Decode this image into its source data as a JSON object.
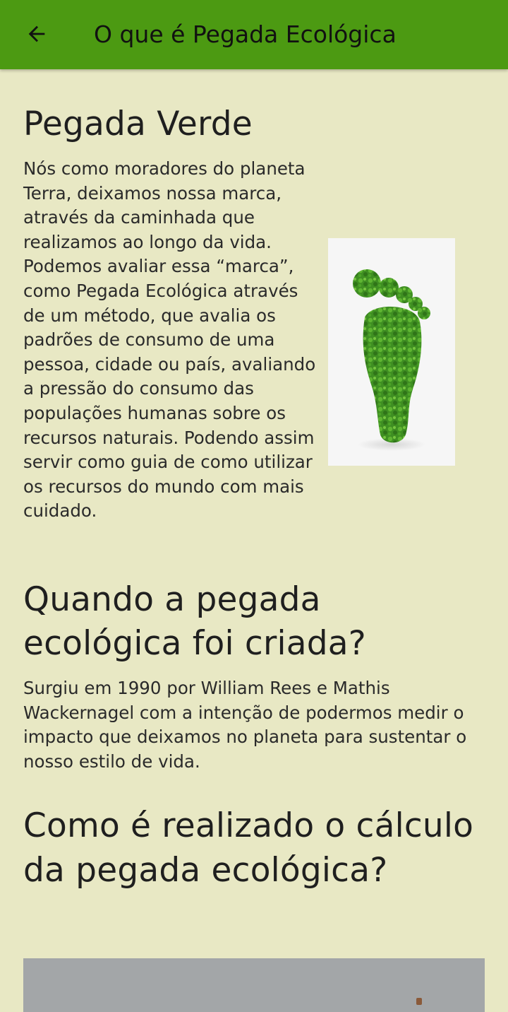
{
  "appbar": {
    "back_icon": "arrow-back-icon",
    "title": "O que é Pegada Ecológica",
    "color": "#4c9a12"
  },
  "sections": {
    "pegada_verde": {
      "heading": "Pegada Verde",
      "body": "Nós como moradores do planeta Terra, deixamos nossa marca, através da caminhada que realizamos ao longo da vida. Podemos avaliar essa “marca”, como Pegada Ecológica através de um método, que avalia os padrões de consumo de uma pessoa, cidade ou país, avaliando a pressão do consumo das populações humanas sobre os recursos naturais. Podendo assim servir como guia de como utilizar os recursos do mundo com mais cuidado.",
      "image": "green-footprint-image"
    },
    "quando": {
      "heading": "Quando a pegada ecológica foi criada?",
      "body": "Surgiu em 1990 por William Rees e Mathis Wackernagel com a intenção de podermos medir o impacto que deixamos no planeta para sustentar o nosso estilo de vida."
    },
    "como": {
      "heading": "Como é realizado o cálculo da pegada ecológica?",
      "image": "calculation-image"
    }
  },
  "colors": {
    "background": "#e8e8c4",
    "foot_green": "#3f8f22"
  }
}
